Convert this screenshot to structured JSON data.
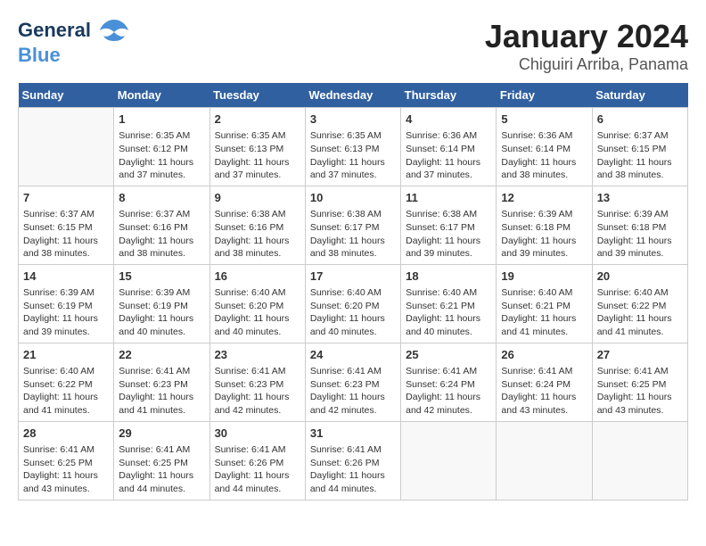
{
  "header": {
    "logo_line1": "General",
    "logo_line2": "Blue",
    "title": "January 2024",
    "subtitle": "Chiguiri Arriba, Panama"
  },
  "days_of_week": [
    "Sunday",
    "Monday",
    "Tuesday",
    "Wednesday",
    "Thursday",
    "Friday",
    "Saturday"
  ],
  "weeks": [
    [
      {
        "day": "",
        "info": ""
      },
      {
        "day": "1",
        "info": "Sunrise: 6:35 AM\nSunset: 6:12 PM\nDaylight: 11 hours\nand 37 minutes."
      },
      {
        "day": "2",
        "info": "Sunrise: 6:35 AM\nSunset: 6:13 PM\nDaylight: 11 hours\nand 37 minutes."
      },
      {
        "day": "3",
        "info": "Sunrise: 6:35 AM\nSunset: 6:13 PM\nDaylight: 11 hours\nand 37 minutes."
      },
      {
        "day": "4",
        "info": "Sunrise: 6:36 AM\nSunset: 6:14 PM\nDaylight: 11 hours\nand 37 minutes."
      },
      {
        "day": "5",
        "info": "Sunrise: 6:36 AM\nSunset: 6:14 PM\nDaylight: 11 hours\nand 38 minutes."
      },
      {
        "day": "6",
        "info": "Sunrise: 6:37 AM\nSunset: 6:15 PM\nDaylight: 11 hours\nand 38 minutes."
      }
    ],
    [
      {
        "day": "7",
        "info": "Sunrise: 6:37 AM\nSunset: 6:15 PM\nDaylight: 11 hours\nand 38 minutes."
      },
      {
        "day": "8",
        "info": "Sunrise: 6:37 AM\nSunset: 6:16 PM\nDaylight: 11 hours\nand 38 minutes."
      },
      {
        "day": "9",
        "info": "Sunrise: 6:38 AM\nSunset: 6:16 PM\nDaylight: 11 hours\nand 38 minutes."
      },
      {
        "day": "10",
        "info": "Sunrise: 6:38 AM\nSunset: 6:17 PM\nDaylight: 11 hours\nand 38 minutes."
      },
      {
        "day": "11",
        "info": "Sunrise: 6:38 AM\nSunset: 6:17 PM\nDaylight: 11 hours\nand 39 minutes."
      },
      {
        "day": "12",
        "info": "Sunrise: 6:39 AM\nSunset: 6:18 PM\nDaylight: 11 hours\nand 39 minutes."
      },
      {
        "day": "13",
        "info": "Sunrise: 6:39 AM\nSunset: 6:18 PM\nDaylight: 11 hours\nand 39 minutes."
      }
    ],
    [
      {
        "day": "14",
        "info": "Sunrise: 6:39 AM\nSunset: 6:19 PM\nDaylight: 11 hours\nand 39 minutes."
      },
      {
        "day": "15",
        "info": "Sunrise: 6:39 AM\nSunset: 6:19 PM\nDaylight: 11 hours\nand 40 minutes."
      },
      {
        "day": "16",
        "info": "Sunrise: 6:40 AM\nSunset: 6:20 PM\nDaylight: 11 hours\nand 40 minutes."
      },
      {
        "day": "17",
        "info": "Sunrise: 6:40 AM\nSunset: 6:20 PM\nDaylight: 11 hours\nand 40 minutes."
      },
      {
        "day": "18",
        "info": "Sunrise: 6:40 AM\nSunset: 6:21 PM\nDaylight: 11 hours\nand 40 minutes."
      },
      {
        "day": "19",
        "info": "Sunrise: 6:40 AM\nSunset: 6:21 PM\nDaylight: 11 hours\nand 41 minutes."
      },
      {
        "day": "20",
        "info": "Sunrise: 6:40 AM\nSunset: 6:22 PM\nDaylight: 11 hours\nand 41 minutes."
      }
    ],
    [
      {
        "day": "21",
        "info": "Sunrise: 6:40 AM\nSunset: 6:22 PM\nDaylight: 11 hours\nand 41 minutes."
      },
      {
        "day": "22",
        "info": "Sunrise: 6:41 AM\nSunset: 6:23 PM\nDaylight: 11 hours\nand 41 minutes."
      },
      {
        "day": "23",
        "info": "Sunrise: 6:41 AM\nSunset: 6:23 PM\nDaylight: 11 hours\nand 42 minutes."
      },
      {
        "day": "24",
        "info": "Sunrise: 6:41 AM\nSunset: 6:23 PM\nDaylight: 11 hours\nand 42 minutes."
      },
      {
        "day": "25",
        "info": "Sunrise: 6:41 AM\nSunset: 6:24 PM\nDaylight: 11 hours\nand 42 minutes."
      },
      {
        "day": "26",
        "info": "Sunrise: 6:41 AM\nSunset: 6:24 PM\nDaylight: 11 hours\nand 43 minutes."
      },
      {
        "day": "27",
        "info": "Sunrise: 6:41 AM\nSunset: 6:25 PM\nDaylight: 11 hours\nand 43 minutes."
      }
    ],
    [
      {
        "day": "28",
        "info": "Sunrise: 6:41 AM\nSunset: 6:25 PM\nDaylight: 11 hours\nand 43 minutes."
      },
      {
        "day": "29",
        "info": "Sunrise: 6:41 AM\nSunset: 6:25 PM\nDaylight: 11 hours\nand 44 minutes."
      },
      {
        "day": "30",
        "info": "Sunrise: 6:41 AM\nSunset: 6:26 PM\nDaylight: 11 hours\nand 44 minutes."
      },
      {
        "day": "31",
        "info": "Sunrise: 6:41 AM\nSunset: 6:26 PM\nDaylight: 11 hours\nand 44 minutes."
      },
      {
        "day": "",
        "info": ""
      },
      {
        "day": "",
        "info": ""
      },
      {
        "day": "",
        "info": ""
      }
    ]
  ]
}
